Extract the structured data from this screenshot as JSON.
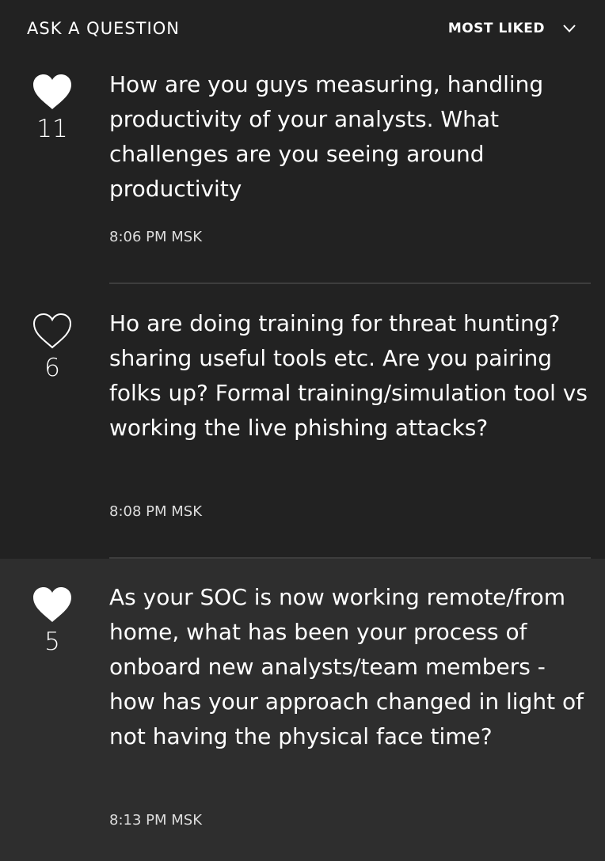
{
  "header": {
    "ask_label": "ASK A QUESTION",
    "sort_label": "MOST LIKED",
    "sort_icon": "chevron-down-icon"
  },
  "questions": [
    {
      "likes": "11",
      "liked": true,
      "text": "How are you guys measuring, handling productivity of your analysts. What challenges are you seeing around productivity",
      "time": "8:06 PM MSK"
    },
    {
      "likes": "6",
      "liked": false,
      "text": "Ho are doing training for threat hunting? sharing useful tools etc. Are you pairing folks up? Formal training/simulation tool vs working the live phishing attacks?",
      "time": "8:08 PM MSK"
    },
    {
      "likes": "5",
      "liked": true,
      "text": "As your SOC is now working remote/from home, what has been your process of onboard new analysts/team members - how has your approach changed in light of not having the physical face time?",
      "time": "8:13 PM MSK"
    }
  ],
  "colors": {
    "background": "#222222",
    "highlight_background": "#2e2e2e",
    "text": "#ffffff",
    "divider": "#3d3d3d"
  }
}
